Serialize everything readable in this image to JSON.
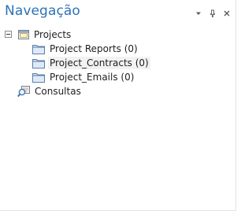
{
  "panel": {
    "title": "Navegação",
    "buttons": [
      {
        "name": "dropdown-icon"
      },
      {
        "name": "pin-icon"
      },
      {
        "name": "close-icon"
      }
    ]
  },
  "tree": {
    "root": {
      "label": "Projects",
      "expanded": true,
      "icon": "project-folder-icon",
      "children": [
        {
          "label": "Project Reports (0)",
          "icon": "folder-icon",
          "selected": false
        },
        {
          "label": "Project_Contracts (0)",
          "icon": "folder-icon",
          "selected": true
        },
        {
          "label": "Project_Emails (0)",
          "icon": "folder-icon",
          "selected": false
        }
      ]
    },
    "queries": {
      "label": "Consultas",
      "icon": "search-query-icon"
    }
  }
}
